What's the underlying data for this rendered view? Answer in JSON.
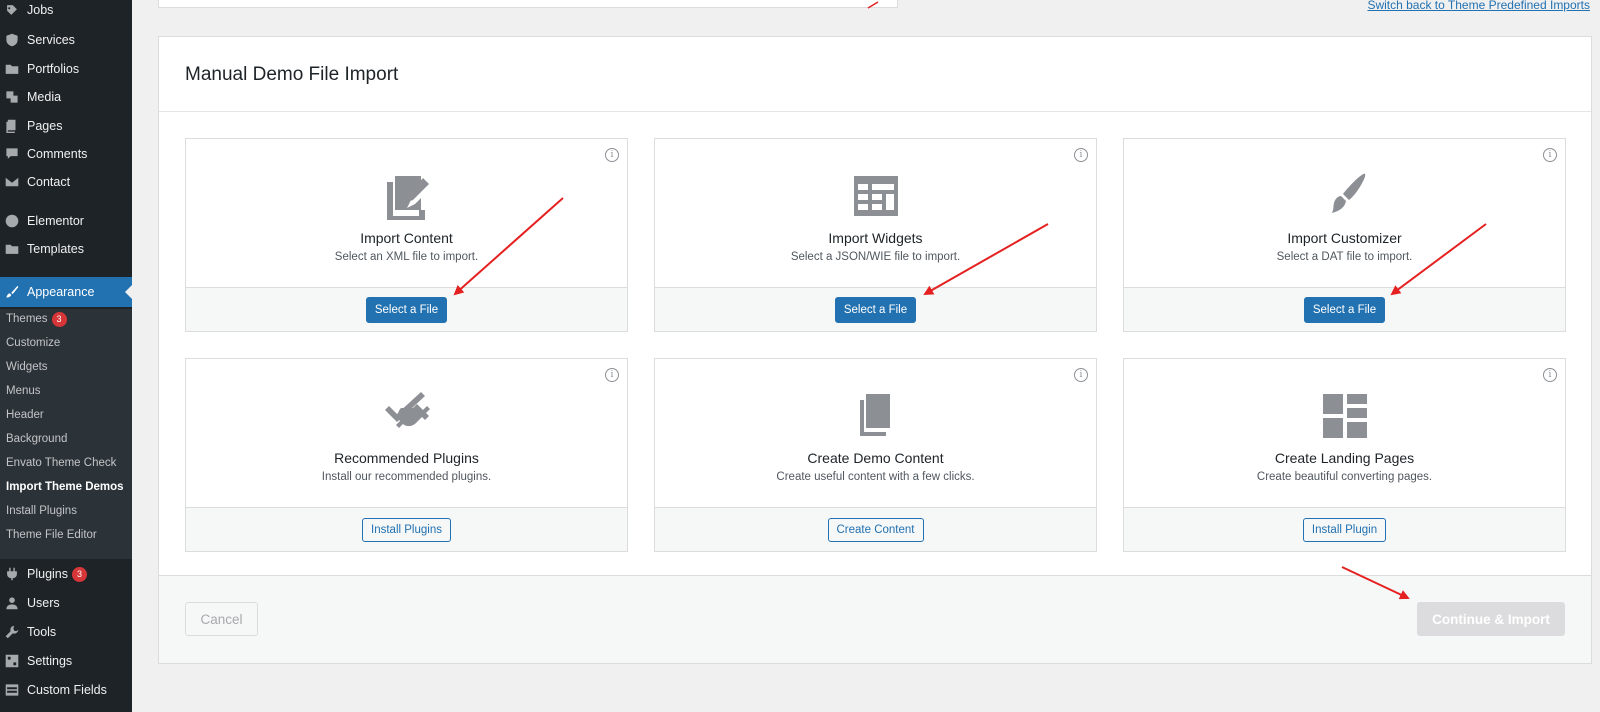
{
  "sidebar": {
    "items": [
      {
        "label": "Jobs",
        "icon": "jobs-icon"
      },
      {
        "label": "Services",
        "icon": "services-icon"
      },
      {
        "label": "Portfolios",
        "icon": "folder-icon"
      },
      {
        "label": "Media",
        "icon": "media-icon"
      },
      {
        "label": "Pages",
        "icon": "pages-icon"
      },
      {
        "label": "Comments",
        "icon": "comment-icon"
      },
      {
        "label": "Contact",
        "icon": "mail-icon"
      },
      {
        "label": "Elementor",
        "icon": "elementor-icon"
      },
      {
        "label": "Templates",
        "icon": "folder-icon"
      },
      {
        "label": "Appearance",
        "icon": "brush-icon"
      },
      {
        "label": "Plugins",
        "icon": "plugin-icon",
        "badge": "3"
      },
      {
        "label": "Users",
        "icon": "user-icon"
      },
      {
        "label": "Tools",
        "icon": "wrench-icon"
      },
      {
        "label": "Settings",
        "icon": "settings-icon"
      },
      {
        "label": "Custom Fields",
        "icon": "table-icon"
      }
    ],
    "submenu": [
      {
        "label": "Themes",
        "badge": "3"
      },
      {
        "label": "Customize"
      },
      {
        "label": "Widgets"
      },
      {
        "label": "Menus"
      },
      {
        "label": "Header"
      },
      {
        "label": "Background"
      },
      {
        "label": "Envato Theme Check"
      },
      {
        "label": "Import Theme Demos",
        "active": true
      },
      {
        "label": "Install Plugins"
      },
      {
        "label": "Theme File Editor"
      }
    ]
  },
  "top": {
    "switch_link": "Switch back to Theme Predefined Imports"
  },
  "panel": {
    "title": "Manual Demo File Import",
    "cards": [
      {
        "title": "Import Content",
        "desc": "Select an XML file to import.",
        "button": "Select a File",
        "icon": "edit-page-icon",
        "primary": true
      },
      {
        "title": "Import Widgets",
        "desc": "Select a JSON/WIE file to import.",
        "button": "Select a File",
        "icon": "widgets-icon",
        "primary": true
      },
      {
        "title": "Import Customizer",
        "desc": "Select a DAT file to import.",
        "button": "Select a File",
        "icon": "brush-icon",
        "primary": true
      },
      {
        "title": "Recommended Plugins",
        "desc": "Install our recommended plugins.",
        "button": "Install Plugins",
        "icon": "plugin-icon",
        "primary": false
      },
      {
        "title": "Create Demo Content",
        "desc": "Create useful content with a few clicks.",
        "button": "Create Content",
        "icon": "pages-icon",
        "primary": false
      },
      {
        "title": "Create Landing Pages",
        "desc": "Create beautiful converting pages.",
        "button": "Install Plugin",
        "icon": "layout-icon",
        "primary": false
      }
    ],
    "info_glyph": "i",
    "cancel": "Cancel",
    "continue": "Continue & Import"
  },
  "colors": {
    "sidebar_bg": "#1d2327",
    "accent": "#2271b1",
    "badge": "#d63638",
    "arrow": "#e52020"
  }
}
